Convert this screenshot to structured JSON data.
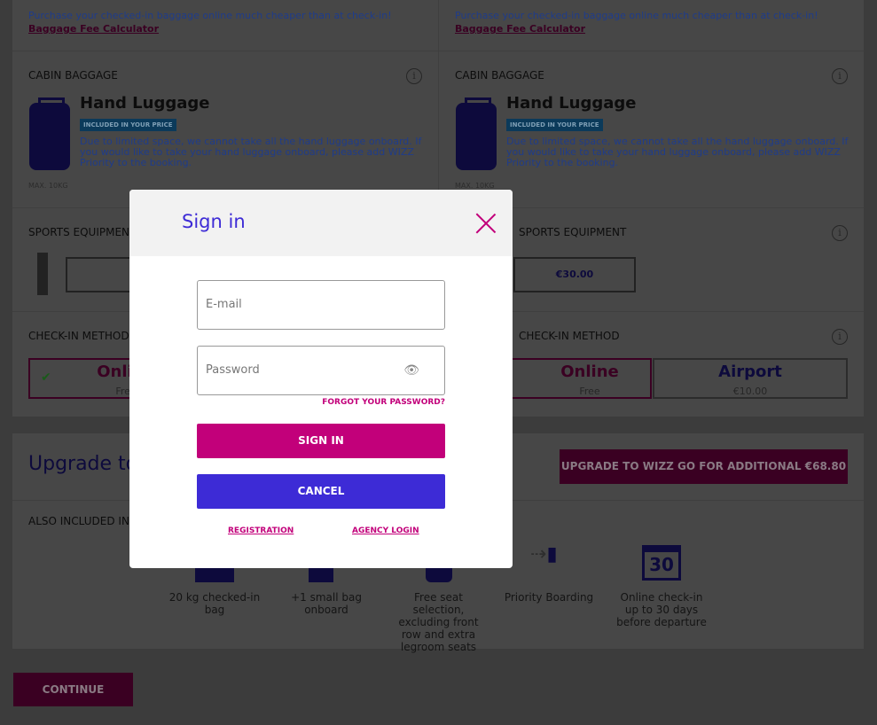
{
  "promo": {
    "text": "Purchase your checked-in baggage online much cheaper than at check-in! ",
    "link": "Baggage Fee Calculator"
  },
  "cabin": {
    "heading": "CABIN BAGGAGE",
    "title": "Hand Luggage",
    "badge": "INCLUDED IN YOUR PRICE",
    "desc": "Due to limited space, we cannot take all the hand luggage onboard. If you would like to take your hand luggage onboard, please add WIZZ Priority to the booking.",
    "max": "MAX. 10KG"
  },
  "sports": {
    "heading": "SPORTS EQUIPMENT",
    "price": "€30.00"
  },
  "checkin": {
    "heading": "CHECK-IN METHOD",
    "online": "Online",
    "online_price": "Free",
    "airport": "Airport",
    "airport_price": "€10.00"
  },
  "info_icon": "i",
  "upgrade": {
    "title": "Upgrade to WIZZ GO",
    "button": "UPGRADE TO WIZZ GO FOR ADDITIONAL €68.80",
    "also": "ALSO INCLUDED IN WIZZ GO",
    "features": [
      "20 kg checked-in bag",
      "+1 small bag onboard",
      "Free seat selection, excluding front row and extra legroom seats",
      "Priority Boarding",
      "Online check-in up to 30 days before departure"
    ],
    "calendar_number": "30"
  },
  "continue": "CONTINUE",
  "modal": {
    "title": "Sign in",
    "email_placeholder": "E-mail",
    "password_placeholder": "Password",
    "forgot": "FORGOT YOUR PASSWORD?",
    "sign_in": "SIGN IN",
    "cancel": "CANCEL",
    "registration": "REGISTRATION",
    "agency": "AGENCY LOGIN"
  },
  "colors": {
    "brand": "#c2007a",
    "primary_blue": "#3d2bd6",
    "navy": "#1a1478"
  }
}
